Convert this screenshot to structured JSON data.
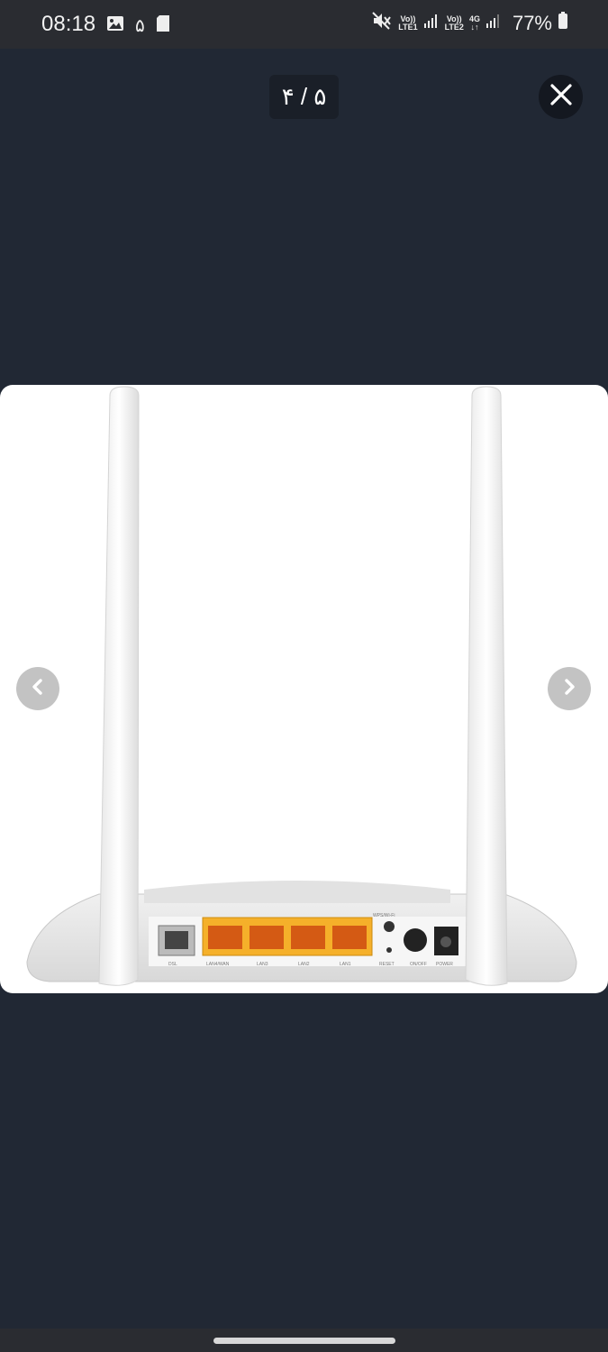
{
  "status_bar": {
    "time": "08:18",
    "notification_digit": "۵",
    "network1_top": "Vo))",
    "network1_bottom": "LTE1",
    "network2_top": "Vo))",
    "network2_bottom": "LTE2",
    "data_type": "4G",
    "battery": "77%",
    "icons": [
      "gallery-icon",
      "sd-card-icon",
      "mute-icon",
      "signal-icon",
      "signal-icon",
      "battery-icon"
    ]
  },
  "viewer": {
    "counter": "۴ / ۵",
    "close_icon": "close-icon",
    "prev_icon": "chevron-left-icon",
    "next_icon": "chevron-right-icon"
  },
  "product_image": {
    "subject": "router-back-panel",
    "port_labels": [
      "DSL",
      "LAN4/WAN",
      "LAN3",
      "LAN2",
      "LAN1",
      "WPS/Wi-Fi",
      "RESET",
      "ON/OFF",
      "POWER"
    ],
    "port_color": "#f5b02a"
  }
}
